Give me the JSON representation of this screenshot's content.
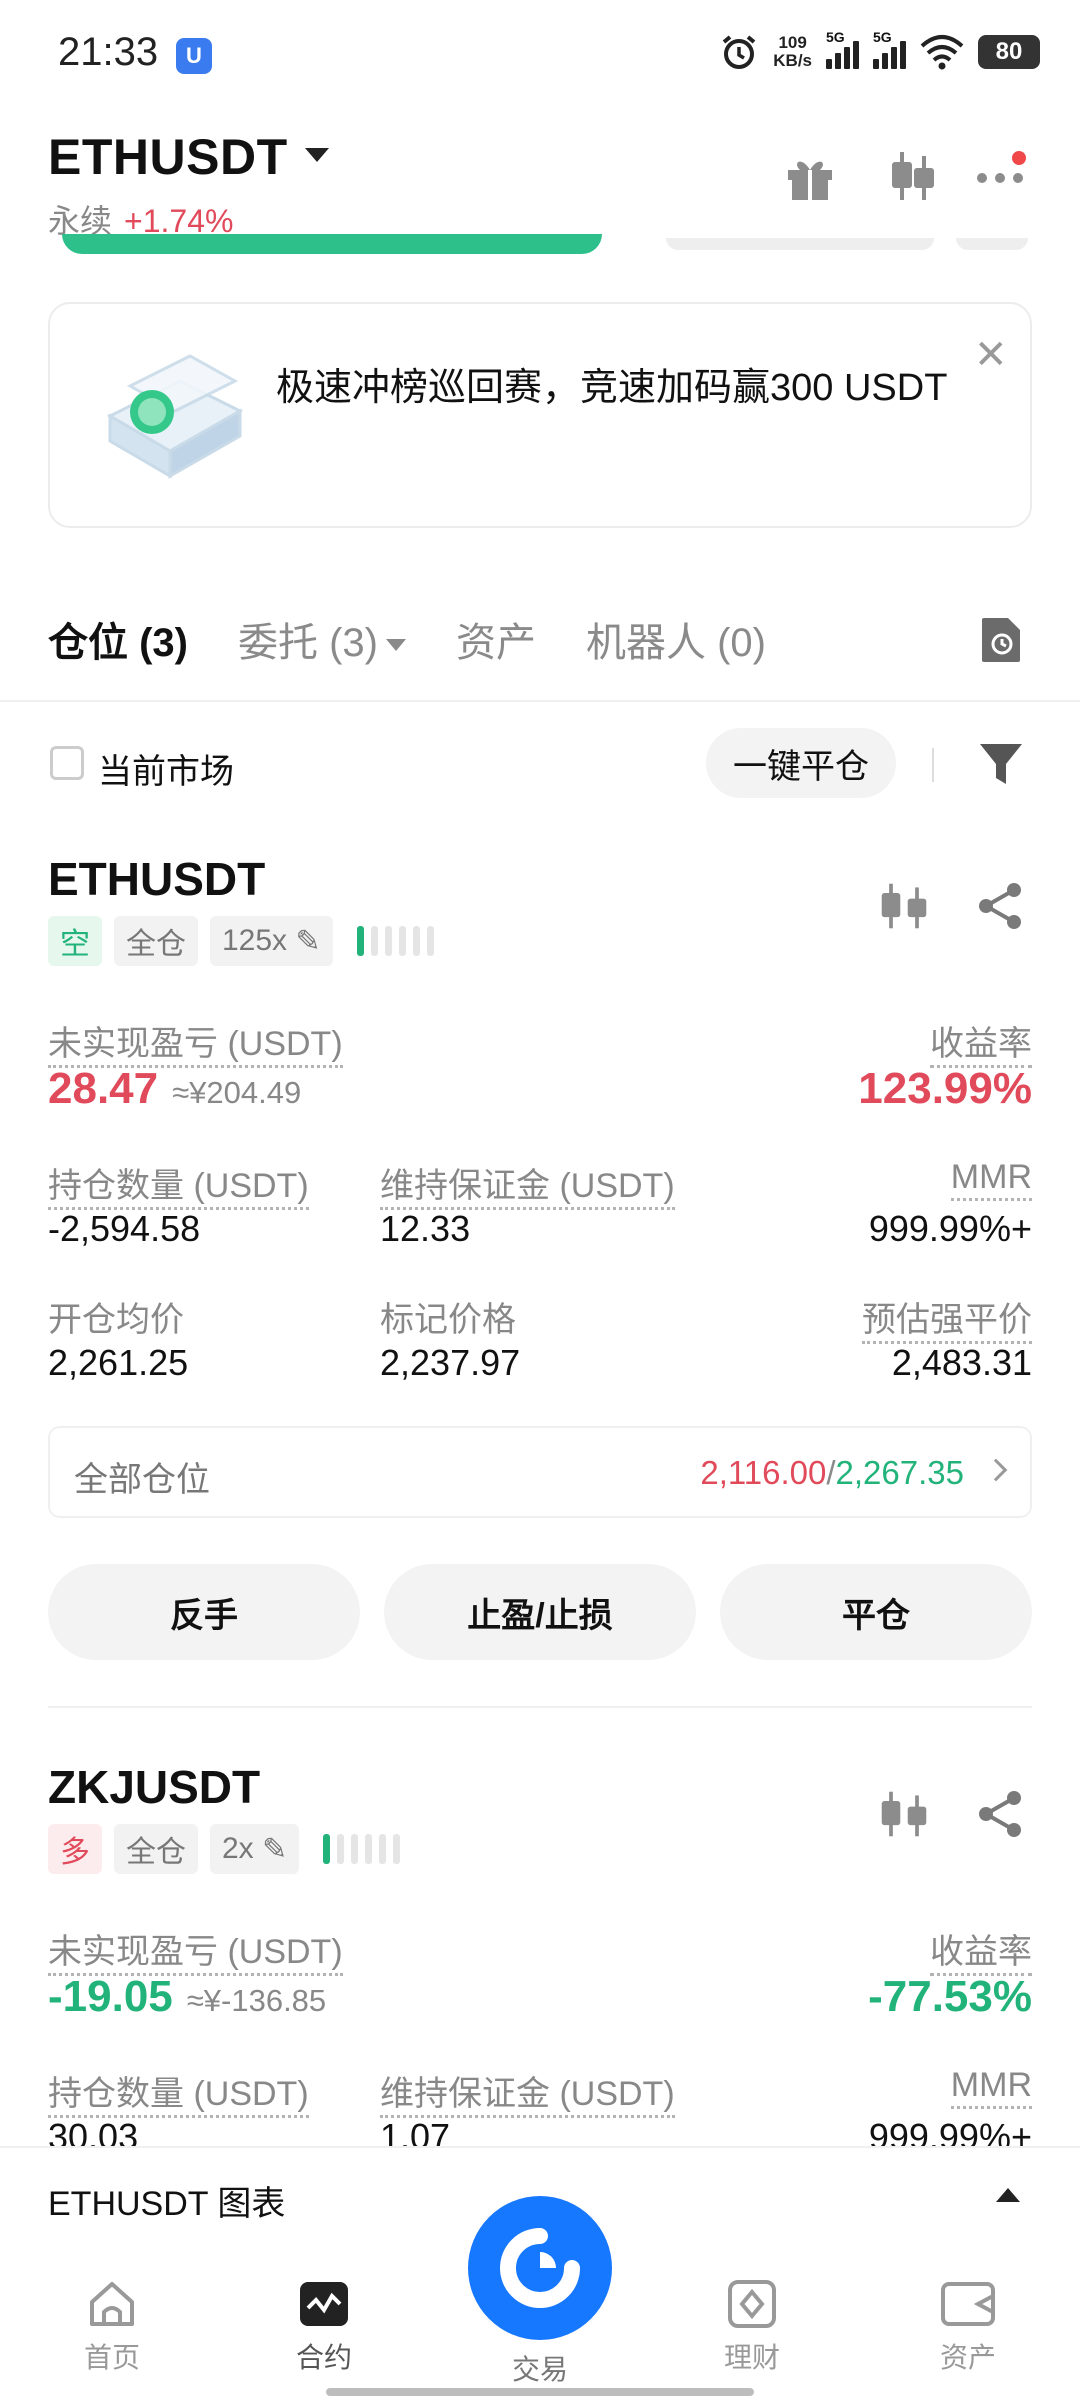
{
  "status_bar": {
    "time": "21:33",
    "app_badge": "U",
    "speed_value": "109",
    "speed_unit": "KB/s",
    "signal1": "5G",
    "signal2": "5G",
    "battery": "80"
  },
  "header": {
    "pair": "ETHUSDT",
    "type_label": "永续",
    "change": "+1.74%"
  },
  "banner": {
    "text": "极速冲榜巡回赛，竞速加码赢300 USDT"
  },
  "tabs": [
    {
      "label": "仓位 (3)"
    },
    {
      "label": "委托 (3)"
    },
    {
      "label": "资产"
    },
    {
      "label": "机器人 (0)"
    }
  ],
  "filter": {
    "current_market_label": "当前市场",
    "close_all_label": "一键平仓"
  },
  "positions": [
    {
      "symbol": "ETHUSDT",
      "side": "空",
      "margin_mode": "全仓",
      "leverage": "125x",
      "unrealized_label": "未实现盈亏 (USDT)",
      "unrealized_value": "28.47",
      "unrealized_cny": "≈¥204.49",
      "roi_label": "收益率",
      "roi_value": "123.99%",
      "size_label": "持仓数量 (USDT)",
      "size_value": "-2,594.58",
      "maint_label": "维持保证金 (USDT)",
      "maint_value": "12.33",
      "mmr_label": "MMR",
      "mmr_value": "999.99%+",
      "entry_label": "开仓均价",
      "entry_value": "2,261.25",
      "mark_label": "标记价格",
      "mark_value": "2,237.97",
      "liq_label": "预估强平价",
      "liq_value": "2,483.31",
      "all_positions_label": "全部仓位",
      "all_positions_red": "2,116.00",
      "all_positions_sep": "/",
      "all_positions_green": "2,267.35",
      "btn_reverse": "反手",
      "btn_tpsl": "止盈/止损",
      "btn_close": "平仓"
    },
    {
      "symbol": "ZKJUSDT",
      "side": "多",
      "margin_mode": "全仓",
      "leverage": "2x",
      "unrealized_label": "未实现盈亏 (USDT)",
      "unrealized_value": "-19.05",
      "unrealized_cny": "≈¥-136.85",
      "roi_label": "收益率",
      "roi_value": "-77.53%",
      "size_label": "持仓数量 (USDT)",
      "size_value": "30.03",
      "maint_label": "维持保证金 (USDT)",
      "maint_value": "1.07",
      "mmr_label": "MMR",
      "mmr_value": "999.99%+"
    }
  ],
  "chart_bar": {
    "label": "ETHUSDT 图表"
  },
  "bottom_nav": [
    {
      "label": "首页"
    },
    {
      "label": "合约"
    },
    {
      "label": "交易"
    },
    {
      "label": "理财"
    },
    {
      "label": "资产"
    }
  ],
  "colors": {
    "up_green": "#22b37a",
    "down_red": "#e14a5a",
    "liq_orange": "#f0903c",
    "brand_blue": "#1677ff"
  }
}
